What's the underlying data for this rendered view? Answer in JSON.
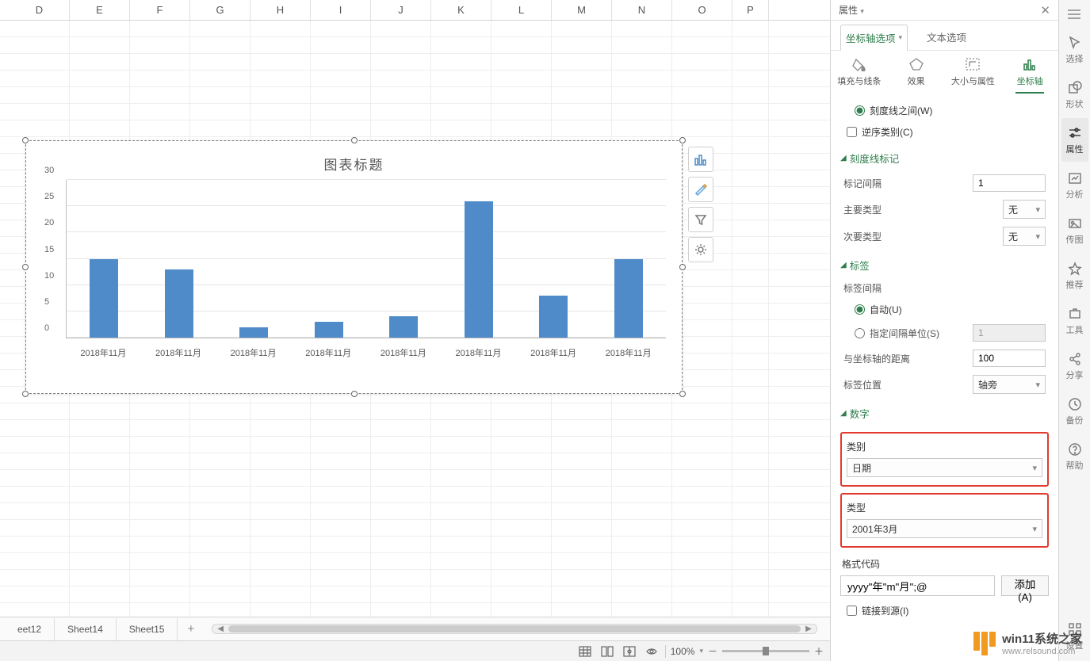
{
  "chart_data": {
    "type": "bar",
    "title": "图表标题",
    "categories": [
      "2018年11月",
      "2018年11月",
      "2018年11月",
      "2018年11月",
      "2018年11月",
      "2018年11月",
      "2018年11月",
      "2018年11月"
    ],
    "values": [
      15,
      13,
      2,
      3,
      4,
      26,
      8,
      15
    ],
    "ylim": [
      0,
      30
    ],
    "yticks": [
      0,
      5,
      10,
      15,
      20,
      25,
      30
    ],
    "xlabel": "",
    "ylabel": ""
  },
  "spreadsheet": {
    "columns": [
      "D",
      "E",
      "F",
      "G",
      "H",
      "I",
      "J",
      "K",
      "L",
      "M",
      "N",
      "O",
      "P"
    ]
  },
  "sheet_tabs": {
    "items": [
      "eet12",
      "Sheet14",
      "Sheet15"
    ],
    "add_label": "+"
  },
  "status_bar": {
    "zoom_text": "100%",
    "zoom_minus": "－",
    "zoom_plus": "＋"
  },
  "props": {
    "title": "属性",
    "close": "✕",
    "tab_axis": "坐标轴选项",
    "tab_text": "文本选项",
    "icon_fill": "填充与线条",
    "icon_effect": "效果",
    "icon_size": "大小与属性",
    "icon_axis": "坐标轴",
    "radio_ticks_between": "刻度线之间(W)",
    "cb_reverse": "逆序类别(C)",
    "sec_tickmarks": "刻度线标记",
    "label_mark_interval": "标记间隔",
    "val_mark_interval": "1",
    "label_major_type": "主要类型",
    "val_major_type": "无",
    "label_minor_type": "次要类型",
    "val_minor_type": "无",
    "sec_labels": "标签",
    "label_label_interval": "标签间隔",
    "radio_auto": "自动(U)",
    "radio_specify": "指定间隔单位(S)",
    "val_specify": "1",
    "label_distance": "与坐标轴的距离",
    "val_distance": "100",
    "label_pos": "标签位置",
    "val_pos": "轴旁",
    "sec_number": "数字",
    "label_category": "类别",
    "val_category": "日期",
    "label_type": "类型",
    "val_type": "2001年3月",
    "label_format_code": "格式代码",
    "val_format_code": "yyyy\"年\"m\"月\";@",
    "btn_add": "添加(A)",
    "cb_link_source": "链接到源(I)"
  },
  "rail": {
    "select": "选择",
    "shape": "形状",
    "props": "属性",
    "analyze": "分析",
    "transfer": "传图",
    "recommend": "推荐",
    "tools": "工具",
    "share": "分享",
    "backup": "备份",
    "help": "帮助",
    "settings": "设置"
  },
  "watermark": {
    "line1": "win11系统之家",
    "line2": "www.relsound.com"
  }
}
